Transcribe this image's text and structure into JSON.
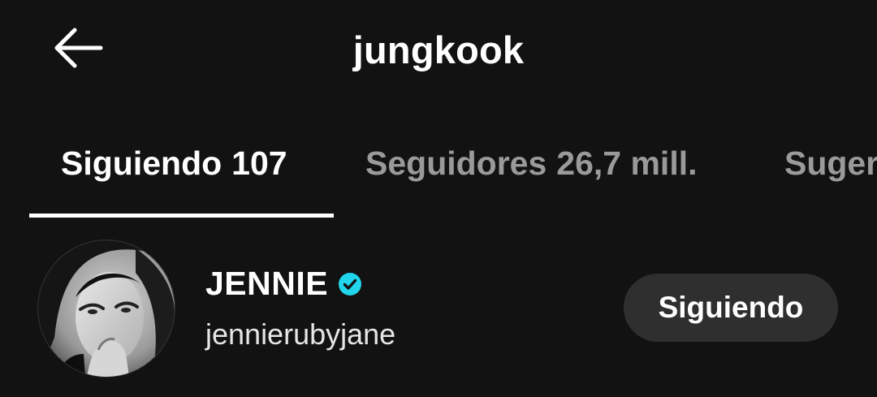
{
  "header": {
    "back_icon": "arrow-left-icon",
    "title": "jungkook"
  },
  "tabs": [
    {
      "label": "Siguiendo",
      "count": "107",
      "active": true
    },
    {
      "label": "Seguidores",
      "count": "26,7 mill.",
      "active": false
    },
    {
      "label": "Sugerencias",
      "count": "",
      "active": false
    }
  ],
  "following_list": [
    {
      "display_name": "JENNIE",
      "verified": true,
      "handle": "jennierubyjane",
      "button_label": "Siguiendo",
      "avatar_icon": "profile-photo"
    }
  ],
  "colors": {
    "background": "#121212",
    "text_primary": "#ffffff",
    "text_inactive": "#9a9a9a",
    "verified": "#20d5ec",
    "button_bg": "#2f2f2f"
  }
}
